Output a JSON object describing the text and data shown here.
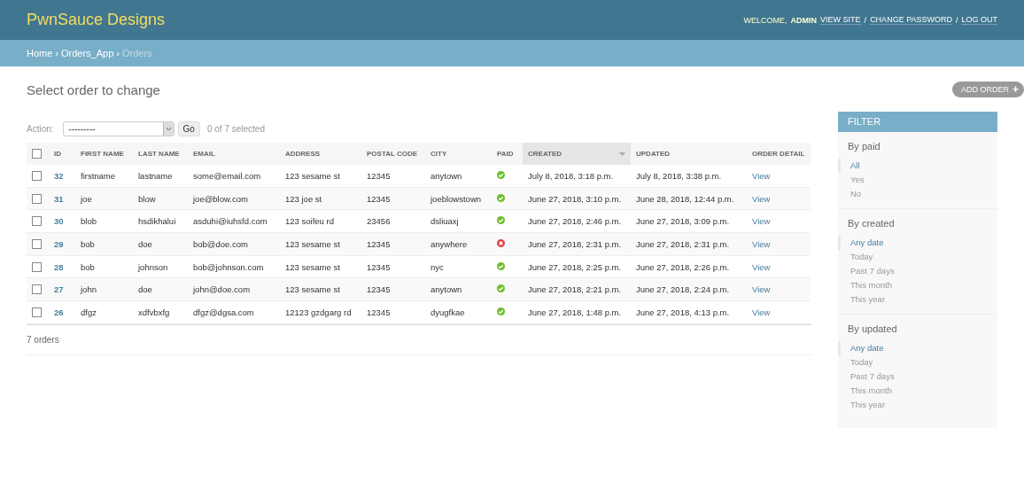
{
  "header": {
    "brand": "PwnSauce Designs",
    "welcome": "WELCOME,",
    "user": "ADMIN",
    "links": [
      "VIEW SITE",
      "CHANGE PASSWORD",
      "LOG OUT"
    ],
    "separator": "/"
  },
  "breadcrumbs": {
    "separator": "›",
    "items": [
      {
        "label": "Home",
        "current": false
      },
      {
        "label": "Orders_App",
        "current": false
      },
      {
        "label": "Orders",
        "current": true
      }
    ]
  },
  "page_title": "Select order to change",
  "add_button": {
    "label": "ADD ORDER",
    "icon": "+"
  },
  "actions": {
    "label": "Action:",
    "select_value": "---------",
    "go": "Go",
    "counter": "0 of 7 selected"
  },
  "table": {
    "columns": [
      {
        "label": "ID",
        "sorted": false
      },
      {
        "label": "FIRST NAME",
        "sorted": false
      },
      {
        "label": "LAST NAME",
        "sorted": false
      },
      {
        "label": "EMAIL",
        "sorted": false
      },
      {
        "label": "ADDRESS",
        "sorted": false
      },
      {
        "label": "POSTAL CODE",
        "sorted": false
      },
      {
        "label": "CITY",
        "sorted": false
      },
      {
        "label": "PAID",
        "sorted": false
      },
      {
        "label": "CREATED",
        "sorted": true
      },
      {
        "label": "UPDATED",
        "sorted": false
      },
      {
        "label": "ORDER DETAIL",
        "sorted": false
      }
    ],
    "select_all_checked": false,
    "rows": [
      {
        "checked": false,
        "id": "32",
        "first_name": "firstname",
        "last_name": "lastname",
        "email": "some@email.com",
        "address": "123 sesame st",
        "postal_code": "12345",
        "city": "anytown",
        "paid": true,
        "created": "July 8, 2018, 3:18 p.m.",
        "updated": "July 8, 2018, 3:38 p.m.",
        "detail": "View"
      },
      {
        "checked": false,
        "id": "31",
        "first_name": "joe",
        "last_name": "blow",
        "email": "joe@blow.com",
        "address": "123 joe st",
        "postal_code": "12345",
        "city": "joeblowstown",
        "paid": true,
        "created": "June 27, 2018, 3:10 p.m.",
        "updated": "June 28, 2018, 12:44 p.m.",
        "detail": "View"
      },
      {
        "checked": false,
        "id": "30",
        "first_name": "blob",
        "last_name": "hsdikhalui",
        "email": "asduhi@iuhsfd.com",
        "address": "123 soifeu rd",
        "postal_code": "23456",
        "city": "dsliuaxj",
        "paid": true,
        "created": "June 27, 2018, 2:46 p.m.",
        "updated": "June 27, 2018, 3:09 p.m.",
        "detail": "View"
      },
      {
        "checked": false,
        "id": "29",
        "first_name": "bob",
        "last_name": "doe",
        "email": "bob@doe.com",
        "address": "123 sesame st",
        "postal_code": "12345",
        "city": "anywhere",
        "paid": false,
        "created": "June 27, 2018, 2:31 p.m.",
        "updated": "June 27, 2018, 2:31 p.m.",
        "detail": "View"
      },
      {
        "checked": false,
        "id": "28",
        "first_name": "bob",
        "last_name": "johnson",
        "email": "bob@johnson.com",
        "address": "123 sesame st",
        "postal_code": "12345",
        "city": "nyc",
        "paid": true,
        "created": "June 27, 2018, 2:25 p.m.",
        "updated": "June 27, 2018, 2:26 p.m.",
        "detail": "View"
      },
      {
        "checked": false,
        "id": "27",
        "first_name": "john",
        "last_name": "doe",
        "email": "john@doe.com",
        "address": "123 sesame st",
        "postal_code": "12345",
        "city": "anytown",
        "paid": true,
        "created": "June 27, 2018, 2:21 p.m.",
        "updated": "June 27, 2018, 2:24 p.m.",
        "detail": "View"
      },
      {
        "checked": false,
        "id": "26",
        "first_name": "dfgz",
        "last_name": "xdfvbxfg",
        "email": "dfgz@dgsa.com",
        "address": "12123 gzdgarg rd",
        "postal_code": "12345",
        "city": "dyugfkae",
        "paid": true,
        "created": "June 27, 2018, 1:48 p.m.",
        "updated": "June 27, 2018, 4:13 p.m.",
        "detail": "View"
      }
    ],
    "footer": "7 orders"
  },
  "filter": {
    "title": "FILTER",
    "groups": [
      {
        "title": "By paid",
        "options": [
          {
            "label": "All",
            "selected": true
          },
          {
            "label": "Yes",
            "selected": false
          },
          {
            "label": "No",
            "selected": false
          }
        ]
      },
      {
        "title": "By created",
        "options": [
          {
            "label": "Any date",
            "selected": true
          },
          {
            "label": "Today",
            "selected": false
          },
          {
            "label": "Past 7 days",
            "selected": false
          },
          {
            "label": "This month",
            "selected": false
          },
          {
            "label": "This year",
            "selected": false
          }
        ]
      },
      {
        "title": "By updated",
        "options": [
          {
            "label": "Any date",
            "selected": true
          },
          {
            "label": "Today",
            "selected": false
          },
          {
            "label": "Past 7 days",
            "selected": false
          },
          {
            "label": "This month",
            "selected": false
          },
          {
            "label": "This year",
            "selected": false
          }
        ]
      }
    ]
  }
}
